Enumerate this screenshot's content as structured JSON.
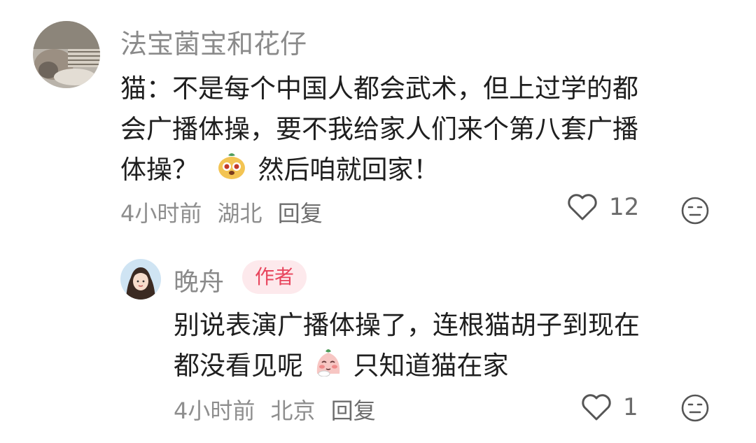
{
  "comments": [
    {
      "username": "法宝菌宝和花仔",
      "content_lines": [
        "猫：不是每个中国人都会武术，但上过学的都",
        "会广播体操，要不我给家人们来个第八套广播"
      ],
      "content_last_before_emoji": "体操？",
      "content_last_after_emoji": "然后咱就回家！",
      "emoji_name": "chestnut-face-emoji",
      "time": "4小时前",
      "location": "湖北",
      "reply_label": "回复",
      "like_count": "12"
    },
    {
      "username": "晚舟",
      "badge": "作者",
      "content_lines": [
        "别说表演广播体操了，连根猫胡子到现在"
      ],
      "content_last_before_emoji": "都没看见呢",
      "content_last_after_emoji": "只知道猫在家",
      "emoji_name": "blushing-face-emoji",
      "time": "4小时前",
      "location": "北京",
      "reply_label": "回复",
      "like_count": "1"
    }
  ],
  "colors": {
    "badge_bg": "#fde9ec",
    "badge_text": "#e8455d",
    "meta": "#8e8e8e"
  }
}
